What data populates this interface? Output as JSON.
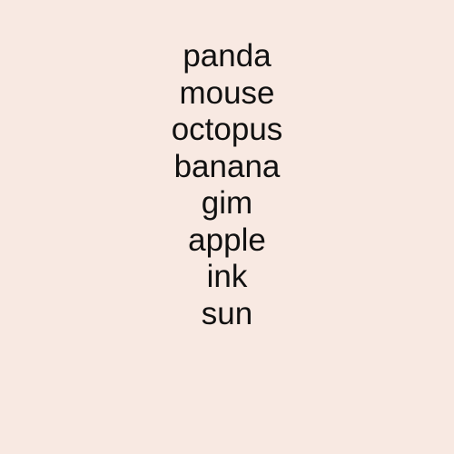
{
  "colors": {
    "background": "#f8e9e2",
    "text": "#111111"
  },
  "words": [
    "panda",
    "mouse",
    "octopus",
    "banana",
    "gim",
    "apple",
    "ink",
    "sun"
  ]
}
